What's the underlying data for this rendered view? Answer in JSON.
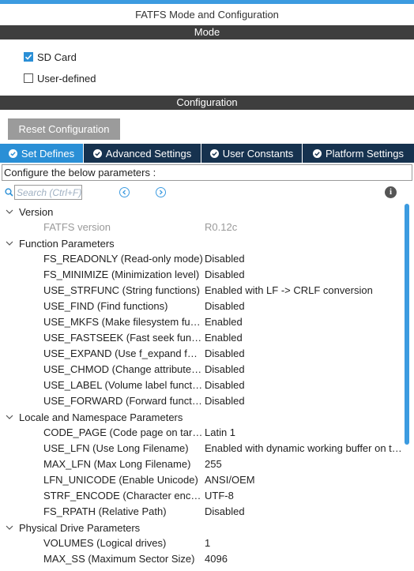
{
  "panel": {
    "title": "FATFS Mode and Configuration"
  },
  "mode": {
    "header": "Mode",
    "options": [
      {
        "label": "SD Card",
        "checked": true
      },
      {
        "label": "User-defined",
        "checked": false
      }
    ]
  },
  "configuration": {
    "header": "Configuration",
    "reset_label": "Reset Configuration",
    "tabs": [
      {
        "label": "Set Defines",
        "active": true
      },
      {
        "label": "Advanced Settings",
        "active": false
      },
      {
        "label": "User Constants",
        "active": false
      },
      {
        "label": "Platform Settings",
        "active": false
      }
    ],
    "instruction": "Configure the below parameters :",
    "search_placeholder": "Search (Ctrl+F)"
  },
  "groups": [
    {
      "title": "Version",
      "params": [
        {
          "name": "FATFS version",
          "value": "R0.12c",
          "dim": true
        }
      ]
    },
    {
      "title": "Function Parameters",
      "params": [
        {
          "name": "FS_READONLY (Read-only mode)",
          "value": "Disabled"
        },
        {
          "name": "FS_MINIMIZE (Minimization level)",
          "value": "Disabled"
        },
        {
          "name": "USE_STRFUNC (String functions)",
          "value": "Enabled with LF -> CRLF conversion"
        },
        {
          "name": "USE_FIND (Find functions)",
          "value": "Disabled"
        },
        {
          "name": "USE_MKFS (Make filesystem functi...",
          "value": "Enabled"
        },
        {
          "name": "USE_FASTSEEK (Fast seek functi...",
          "value": "Enabled"
        },
        {
          "name": "USE_EXPAND (Use f_expand func...",
          "value": "Disabled"
        },
        {
          "name": "USE_CHMOD (Change attributes f...",
          "value": "Disabled"
        },
        {
          "name": "USE_LABEL (Volume label function...",
          "value": "Disabled"
        },
        {
          "name": "USE_FORWARD (Forward function)",
          "value": "Disabled"
        }
      ]
    },
    {
      "title": "Locale and Namespace Parameters",
      "params": [
        {
          "name": "CODE_PAGE (Code page on targ...",
          "value": "Latin 1"
        },
        {
          "name": "USE_LFN (Use Long Filename)",
          "value": "Enabled with dynamic working buffer on the ..."
        },
        {
          "name": "MAX_LFN (Max Long Filename)",
          "value": "255"
        },
        {
          "name": "LFN_UNICODE (Enable Unicode)",
          "value": "ANSI/OEM"
        },
        {
          "name": "STRF_ENCODE (Character encod...",
          "value": "UTF-8"
        },
        {
          "name": "FS_RPATH (Relative Path)",
          "value": "Disabled"
        }
      ]
    },
    {
      "title": "Physical Drive Parameters",
      "params": [
        {
          "name": "VOLUMES (Logical drives)",
          "value": "1"
        },
        {
          "name": "MAX_SS (Maximum Sector Size)",
          "value": "4096"
        }
      ]
    }
  ],
  "colors": {
    "accent": "#2a8fd6",
    "tab_bar": "#16324f",
    "section_header": "#3e3e3e",
    "reset_button": "#9b9b9b"
  }
}
